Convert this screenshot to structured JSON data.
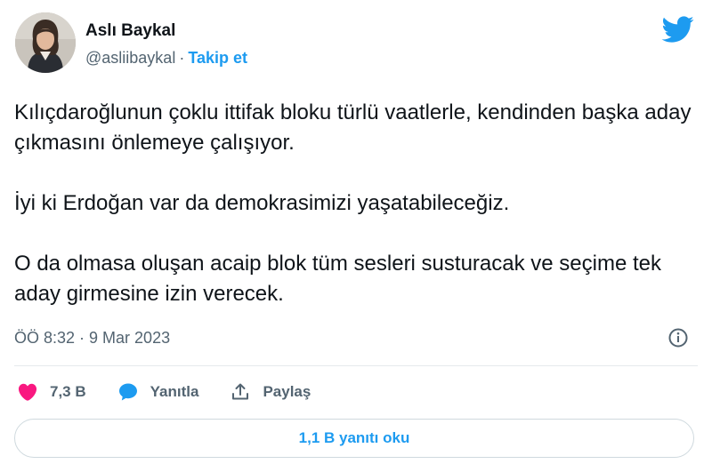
{
  "author": {
    "display_name": "Aslı Baykal",
    "handle": "@asliibaykal",
    "separator": "·",
    "follow_label": "Takip et"
  },
  "tweet": {
    "paragraphs": [
      "Kılıçdaroğlunun çoklu ittifak bloku türlü vaatlerle, kendinden başka aday çıkmasını önlemeye çalışıyor.",
      "İyi ki Erdoğan var da demokrasimizi yaşatabileceğiz.",
      "O da olmasa oluşan acaip blok tüm sesleri susturacak ve seçime tek aday girmesine izin verecek."
    ],
    "timestamp": "ÖÖ 8:32 · 9 Mar 2023"
  },
  "actions": {
    "like_count": "7,3 B",
    "reply_label": "Yanıtla",
    "share_label": "Paylaş"
  },
  "read_replies_label": "1,1 B yanıtı oku",
  "colors": {
    "accent": "#1d9bf0",
    "like": "#f91880",
    "secondary_text": "#536471",
    "primary_text": "#0f1419"
  },
  "icons": {
    "brand": "twitter-bird-icon",
    "info": "info-icon",
    "like": "heart-icon",
    "reply": "speech-bubble-icon",
    "share": "share-upload-icon"
  }
}
